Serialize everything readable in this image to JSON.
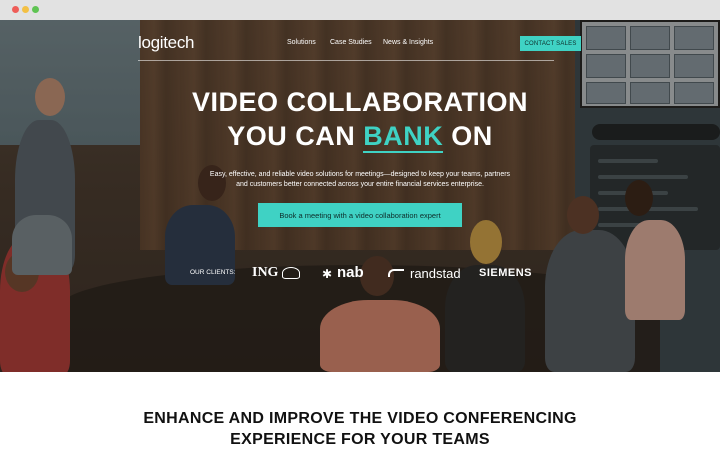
{
  "browser": {
    "window_controls": [
      "close",
      "minimize",
      "maximize"
    ]
  },
  "nav": {
    "logo": "logitech",
    "links": [
      "Solutions",
      "Case Studies",
      "News & Insights"
    ],
    "contact_label": "CONTACT SALES"
  },
  "hero": {
    "headline_line1": "VIDEO COLLABORATION",
    "headline_line2_pre": "YOU CAN ",
    "headline_highlight": "BANK",
    "headline_line2_post": " ON",
    "subtext_line1": "Easy, effective, and reliable video solutions for meetings—designed to keep your teams, partners",
    "subtext_line2": "and customers better connected across your entire financial services enterprise.",
    "cta_label": "Book a meeting with a video collaboration expert",
    "clients_label": "OUR CLIENTS:",
    "clients": [
      "ING",
      "nab",
      "randstad",
      "SIEMENS"
    ],
    "accent_color": "#3fd2c4"
  },
  "section": {
    "title_line1": "ENHANCE AND IMPROVE THE VIDEO CONFERENCING",
    "title_line2": "EXPERIENCE FOR YOUR TEAMS"
  }
}
